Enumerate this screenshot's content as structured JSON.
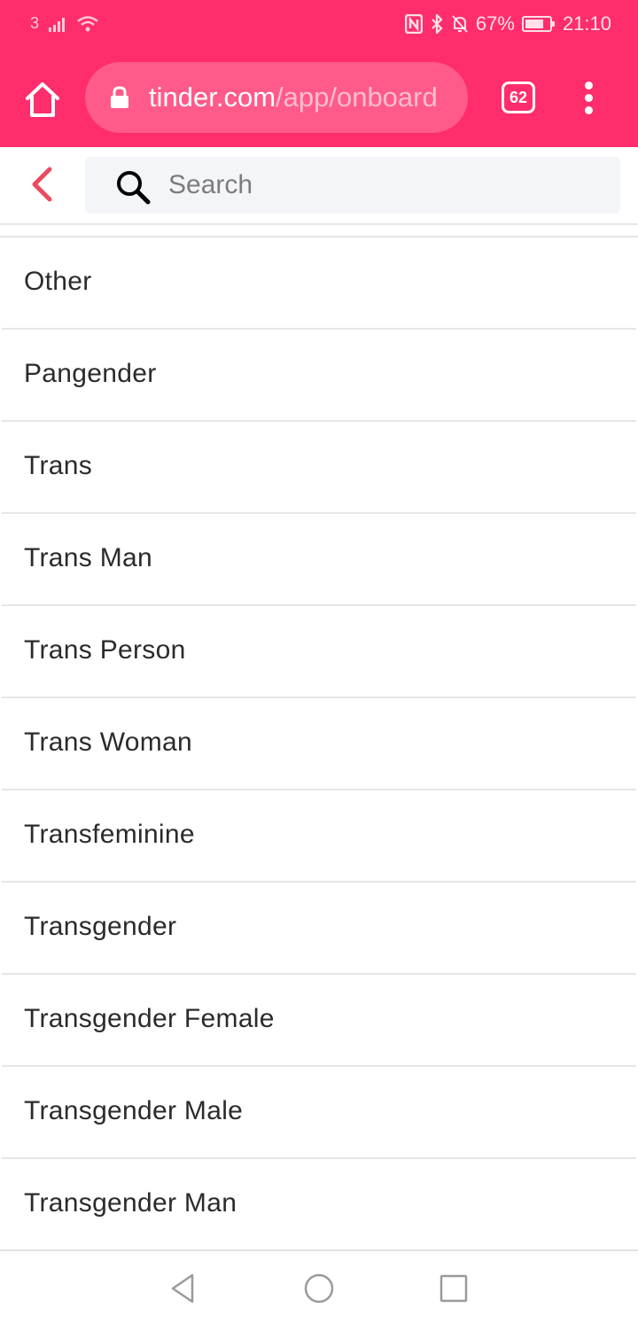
{
  "status_bar": {
    "carrier_label": "3",
    "battery_percent": "67%",
    "time": "21:10",
    "icons": [
      "signal-icon",
      "wifi-icon",
      "nfc-icon",
      "bluetooth-icon",
      "bell-off-icon",
      "battery-icon"
    ]
  },
  "browser": {
    "url_domain": "tinder.com",
    "url_path": "/app/onboard",
    "tab_count": "62",
    "accent_color": "#ff2d6b"
  },
  "search": {
    "placeholder": "Search",
    "value": ""
  },
  "options": [
    "Other",
    "Pangender",
    "Trans",
    "Trans Man",
    "Trans Person",
    "Trans Woman",
    "Transfeminine",
    "Transgender",
    "Transgender Female",
    "Transgender Male",
    "Transgender Man"
  ],
  "colors": {
    "back_arrow": "#ea4c5f",
    "divider": "#e6e6e6",
    "text": "#2b2b2b"
  }
}
